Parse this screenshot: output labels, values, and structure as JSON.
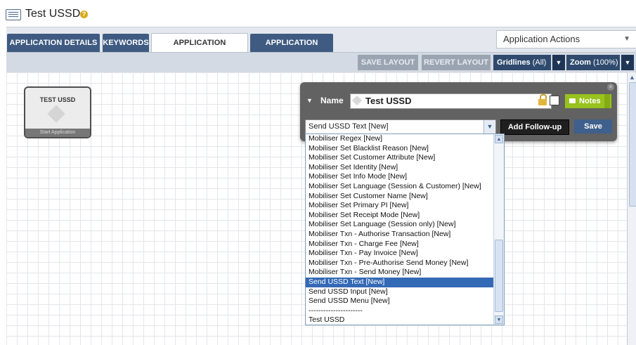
{
  "window": {
    "title": "Test USSD"
  },
  "tabs": [
    {
      "label": "APPLICATION DETAILS"
    },
    {
      "label": "KEYWORDS"
    },
    {
      "label": "APPLICATION COMPOSER"
    },
    {
      "label": "APPLICATION EDITOR"
    }
  ],
  "actions": {
    "selected": "Application Actions"
  },
  "toolbar": {
    "save_layout": "SAVE LAYOUT",
    "revert_layout": "REVERT LAYOUT",
    "gridlines_label": "Gridlines",
    "gridlines_value": "(All)",
    "zoom_label": "Zoom",
    "zoom_value": "(100%)"
  },
  "node": {
    "title": "TEST USSD",
    "footer": "Start Application"
  },
  "panel": {
    "name_label": "Name",
    "name_value": "Test USSD",
    "notes_label": "Notes",
    "select_value": "Send USSD Text [New]",
    "follow_up_label": "Add Follow-up",
    "save_label": "Save"
  },
  "dropdown": {
    "options": [
      "Mobiliser Regex [New]",
      "Mobiliser Set Blacklist Reason [New]",
      "Mobiliser Set Customer Attribute [New]",
      "Mobiliser Set Identity [New]",
      "Mobiliser Set Info Mode [New]",
      "Mobiliser Set Language (Session & Customer) [New]",
      "Mobiliser Set Customer Name [New]",
      "Mobiliser Set Primary PI [New]",
      "Mobiliser Set Receipt Mode [New]",
      "Mobiliser Set Language (Session only) [New]",
      "Mobiliser Txn - Authorise Transaction [New]",
      "Mobiliser Txn - Charge Fee [New]",
      "Mobiliser Txn - Pay Invoice [New]",
      "Mobiliser Txn - Pre-Authorise Send Money [New]",
      "Mobiliser Txn - Send Money [New]",
      "Send USSD Text [New]",
      "Send USSD Input [New]",
      "Send USSD Menu [New]",
      "----------------------",
      "Test USSD"
    ],
    "selected_index": 15
  }
}
